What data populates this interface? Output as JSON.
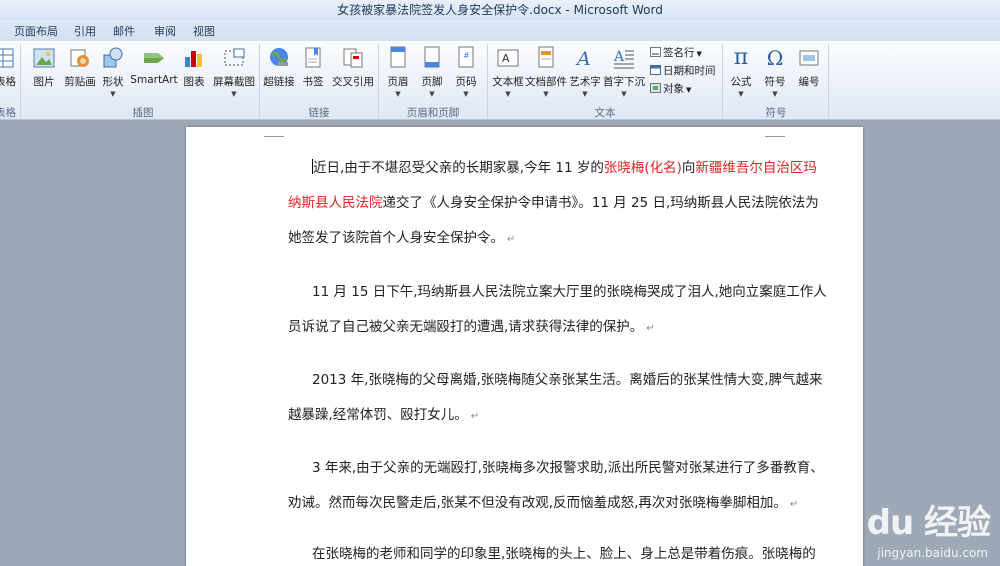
{
  "window": {
    "title": "女孩被家暴法院签发人身安全保护令.docx - Microsoft Word"
  },
  "tabs": [
    "页面布局",
    "引用",
    "邮件",
    "审阅",
    "视图"
  ],
  "ribbon": {
    "left_partial": {
      "label": "表格",
      "group": "表格"
    },
    "illustrations": {
      "buttons": [
        "图片",
        "剪贴画",
        "形状",
        "SmartArt",
        "图表",
        "屏幕截图"
      ],
      "group": "插图"
    },
    "links": {
      "buttons": [
        "超链接",
        "书签",
        "交叉引用"
      ],
      "group": "链接"
    },
    "header_footer": {
      "buttons": [
        "页眉",
        "页脚",
        "页码"
      ],
      "group": "页眉和页脚"
    },
    "text": {
      "buttons": [
        "文本框",
        "文档部件",
        "艺术字",
        "首字下沉"
      ],
      "small": [
        "签名行",
        "日期和时间",
        "对象"
      ],
      "group": "文本"
    },
    "symbols": {
      "buttons": [
        "公式",
        "符号",
        "编号"
      ],
      "group": "符号",
      "formula_glyph": "π",
      "symbol_glyph": "Ω"
    }
  },
  "document": {
    "paragraphs": [
      [
        [
          {
            "t": "近日,由于不堪忍受父亲的长期家暴,今年 11 岁的"
          },
          {
            "t": "张晓梅(化名)",
            "red": true
          },
          {
            "t": "向"
          },
          {
            "t": "新疆维吾尔自治区玛",
            "red": true
          }
        ],
        [
          {
            "t": "纳斯县人民法院",
            "red": true
          },
          {
            "t": "递交了《人身安全保护令申请书》。11 月 25 日,玛纳斯县人民法院依法为"
          }
        ],
        [
          {
            "t": "她签发了该院首个人身安全保护令。"
          }
        ]
      ],
      [
        [
          {
            "t": "11 月 15 日下午,玛纳斯县人民法院立案大厅里的张晓梅哭成了泪人,她向立案庭工作人"
          }
        ],
        [
          {
            "t": "员诉说了自己被父亲无端殴打的遭遇,请求获得法律的保护。"
          }
        ]
      ],
      [
        [
          {
            "t": "2013 年,张晓梅的父母离婚,张晓梅随父亲张某生活。离婚后的张某性情大变,脾气越来"
          }
        ],
        [
          {
            "t": "越暴躁,经常体罚、殴打女儿。"
          }
        ]
      ],
      [
        [
          {
            "t": "3 年来,由于父亲的无端殴打,张晓梅多次报警求助,派出所民警对张某进行了多番教育、"
          }
        ],
        [
          {
            "t": "劝诫。然而每次民警走后,张某不但没有改观,反而恼羞成怒,再次对张晓梅拳脚相加。"
          }
        ]
      ],
      [
        [
          {
            "t": "在张晓梅的老师和同学的印象里,张晓梅的头上、脸上、身上总是带着伤痕。张晓梅的"
          }
        ]
      ]
    ],
    "paragraph_mark": "↵"
  },
  "watermark": {
    "main": "Bai du 经验",
    "sub": "jingyan.baidu.com"
  }
}
